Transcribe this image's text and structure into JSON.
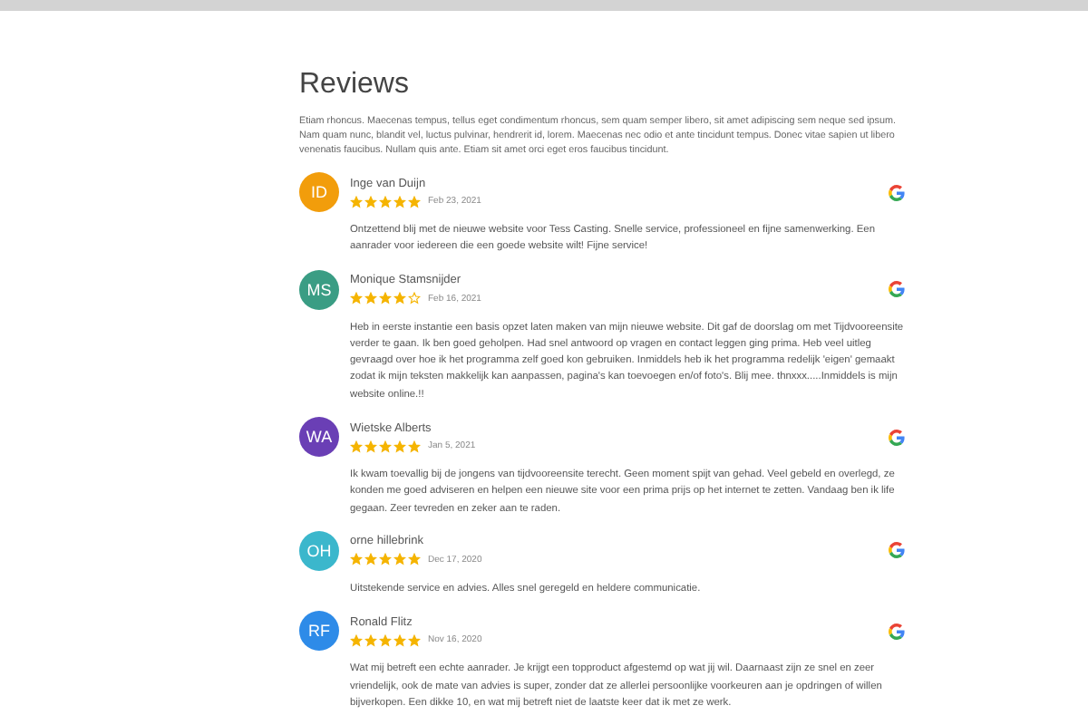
{
  "heading": "Reviews",
  "intro": "Etiam rhoncus. Maecenas tempus, tellus eget condimentum rhoncus, sem quam semper libero, sit amet adipiscing sem neque sed ipsum. Nam quam nunc, blandit vel, luctus pulvinar, hendrerit id, lorem. Maecenas nec odio et ante tincidunt tempus. Donec vitae sapien ut libero venenatis faucibus. Nullam quis ante. Etiam sit amet orci eget eros faucibus tincidunt.",
  "reviews": [
    {
      "initials": "ID",
      "color": "#f29d0b",
      "name": "Inge van Duijn",
      "stars": 5,
      "date": "Feb 23, 2021",
      "text": "Ontzettend blij met de nieuwe website voor Tess Casting. Snelle service, professioneel en fijne samenwerking. Een aanrader voor iedereen die een goede website wilt! Fijne service!"
    },
    {
      "initials": "MS",
      "color": "#3a9d84",
      "name": "Monique Stamsnijder",
      "stars": 4,
      "date": "Feb 16, 2021",
      "text": "Heb in eerste instantie een basis opzet laten maken van mijn nieuwe website. Dit gaf de doorslag om met Tijdvooreensite verder te gaan. Ik ben goed geholpen. Had snel antwoord op vragen en contact leggen ging prima. Heb veel uitleg gevraagd over hoe ik het programma zelf goed kon gebruiken. Inmiddels heb ik het programma redelijk 'eigen' gemaakt zodat ik mijn teksten makkelijk kan aanpassen, pagina's kan toevoegen en/of foto's. Blij mee. thnxxx.....Inmiddels is mijn website online.!!"
    },
    {
      "initials": "WA",
      "color": "#6a3fb5",
      "name": "Wietske Alberts",
      "stars": 5,
      "date": "Jan 5, 2021",
      "text": "Ik kwam toevallig bij de jongens van tijdvooreensite terecht. Geen moment spijt van gehad. Veel gebeld en overlegd, ze konden me goed adviseren en helpen een nieuwe site voor een prima prijs op het internet te zetten. Vandaag ben ik life gegaan. Zeer tevreden en zeker aan te raden."
    },
    {
      "initials": "OH",
      "color": "#3bb7cc",
      "name": "orne hillebrink",
      "stars": 5,
      "date": "Dec 17, 2020",
      "text": "Uitstekende service en advies. Alles snel geregeld en heldere communicatie."
    },
    {
      "initials": "RF",
      "color": "#2e8be8",
      "name": "Ronald Flitz",
      "stars": 5,
      "date": "Nov 16, 2020",
      "text": "Wat mij betreft een echte aanrader. Je krijgt een topproduct afgestemd op wat jij wil. Daarnaast zijn ze snel en zeer vriendelijk, ook de mate van advies is super, zonder dat ze allerlei persoonlijke voorkeuren aan je opdringen of willen bijverkopen. Een dikke 10, en wat mij betreft niet de laatste keer dat ik met ze werk."
    }
  ]
}
